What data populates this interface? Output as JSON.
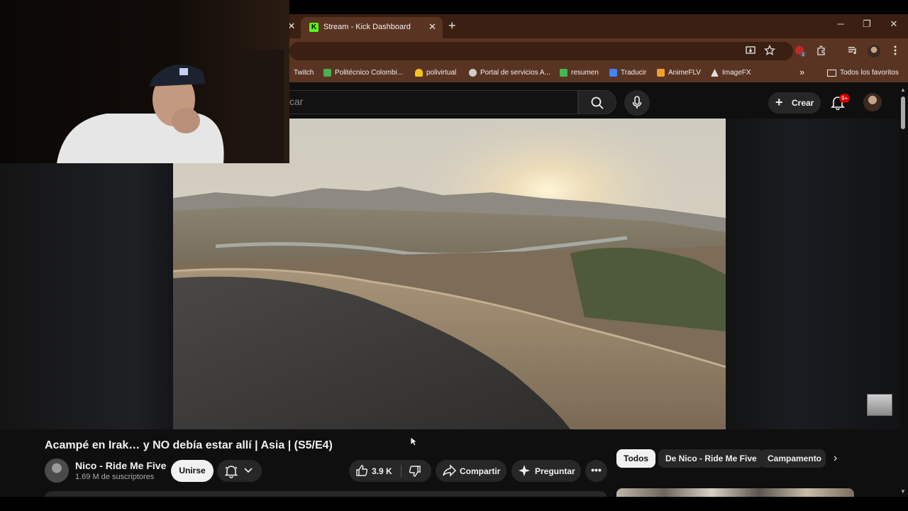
{
  "browser": {
    "active_tab_title": "Stream - Kick Dashboard",
    "new_tab_symbol": "+",
    "window_controls": {
      "minimize": "─",
      "restore": "❐",
      "close": "✕"
    },
    "tab_close_symbol": "✕",
    "bookmarks": [
      {
        "label": "Twitch",
        "icon_color": "#9146ff"
      },
      {
        "label": "Politécnico Colombi...",
        "icon_color": "#4caf50"
      },
      {
        "label": "polivirtual",
        "icon_color": "#f5c518"
      },
      {
        "label": "Portal de servicios A...",
        "icon_color": "#cccccc"
      },
      {
        "label": "resumen",
        "icon_color": "#3fb950"
      },
      {
        "label": "Traducir",
        "icon_color": "#4285f4"
      },
      {
        "label": "AnimeFLV",
        "icon_color": "#f0a030"
      },
      {
        "label": "ImageFX",
        "icon_color": "#dddddd"
      }
    ],
    "bookmarks_overflow": "»",
    "all_bookmarks_label": "Todos los favoritos"
  },
  "youtube": {
    "search_placeholder_visible": "car",
    "create_label": "Crear",
    "notifications_badge": "9+",
    "video_title": "Acampé en Irak… y NO debía estar allí | Asia | (S5/E4)",
    "channel_name": "Nico - Ride Me Five",
    "subscribers": "1.69 M de suscriptores",
    "join_label": "Unirse",
    "likes": "3.9 K",
    "share_label": "Compartir",
    "ask_label": "Preguntar",
    "more_label": "•••",
    "chips": [
      "Todos",
      "De Nico - Ride Me Five",
      "Campamento"
    ],
    "chip_next": "›"
  },
  "colors": {
    "tab_bar": "#3a1f12",
    "toolbar": "#5a3422",
    "yt_background": "#0f0f0f",
    "kick_green": "#53fc18",
    "badge_red": "#cc0000"
  }
}
